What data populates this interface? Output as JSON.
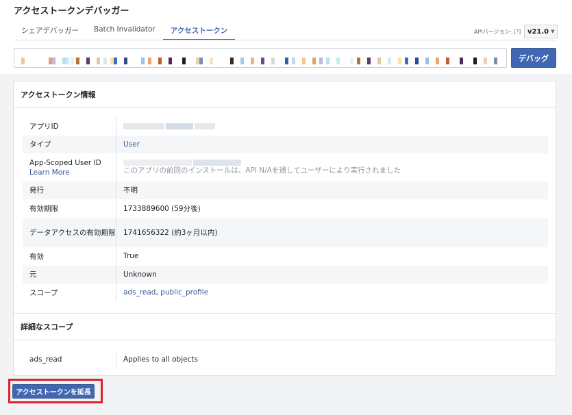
{
  "header": {
    "title": "アクセストークンデバッガー",
    "tabs": [
      {
        "label": "シェアデバッガー"
      },
      {
        "label": "Batch Invalidator"
      },
      {
        "label": "アクセストークン"
      }
    ],
    "api_version_label": "APIバージョン: [?]",
    "api_version_value": "v21.0",
    "debug_label": "デバッグ"
  },
  "token_field": {
    "redaction_colors": [
      "#f7c48d",
      "#e0a36b",
      "#c6b6d9",
      "#b4e1f2",
      "#cbe9f5",
      "#e6f2f6",
      "#b8732e",
      "#5b3a66",
      "#e9c6a2",
      "#d7e7f0",
      "#ffe1a8",
      "#3a6cc8",
      "#2b4c8a",
      "#9cc2e8",
      "#f2a46a",
      "#c45f2a",
      "#4a2f5a",
      "#1d1d2a",
      "#e7d0b3",
      "#7c8fb0",
      "#f4e1c2",
      "#3c2a20",
      "#a8c9ef",
      "#f0b37a",
      "#6a4c8c",
      "#d8d8d8",
      "#2e5fb3",
      "#c2d9f0"
    ]
  },
  "colors": {
    "accent": "#4267b2",
    "link": "#385898",
    "highlight": "#e0202a"
  },
  "info": {
    "section_title": "アクセストークン情報",
    "rows": [
      {
        "key": "アプリID",
        "value": ""
      },
      {
        "key": "タイプ",
        "value": "User"
      },
      {
        "key": "App-Scoped User ID",
        "key_link": "Learn More",
        "value": "",
        "value_sub": "このアプリの前回のインストールは、API N/Aを通してユーザーにより実行されました"
      },
      {
        "key": "発行",
        "value": "不明"
      },
      {
        "key": "有効期限",
        "value": "1733889600 (59分後)"
      },
      {
        "key": "データアクセスの有効期限",
        "value": "1741656322 (約3ヶ月以内)"
      },
      {
        "key": "有効",
        "value": "True"
      },
      {
        "key": "元",
        "value": "Unknown"
      },
      {
        "key": "スコープ",
        "scope_1": "ads_read",
        "scope_sep": ", ",
        "scope_2": "public_profile"
      }
    ]
  },
  "detail": {
    "section_title": "詳細なスコープ",
    "row": {
      "key": "ads_read",
      "value": "Applies to all objects"
    }
  },
  "extend_button": {
    "label": "アクセストークンを延長"
  }
}
